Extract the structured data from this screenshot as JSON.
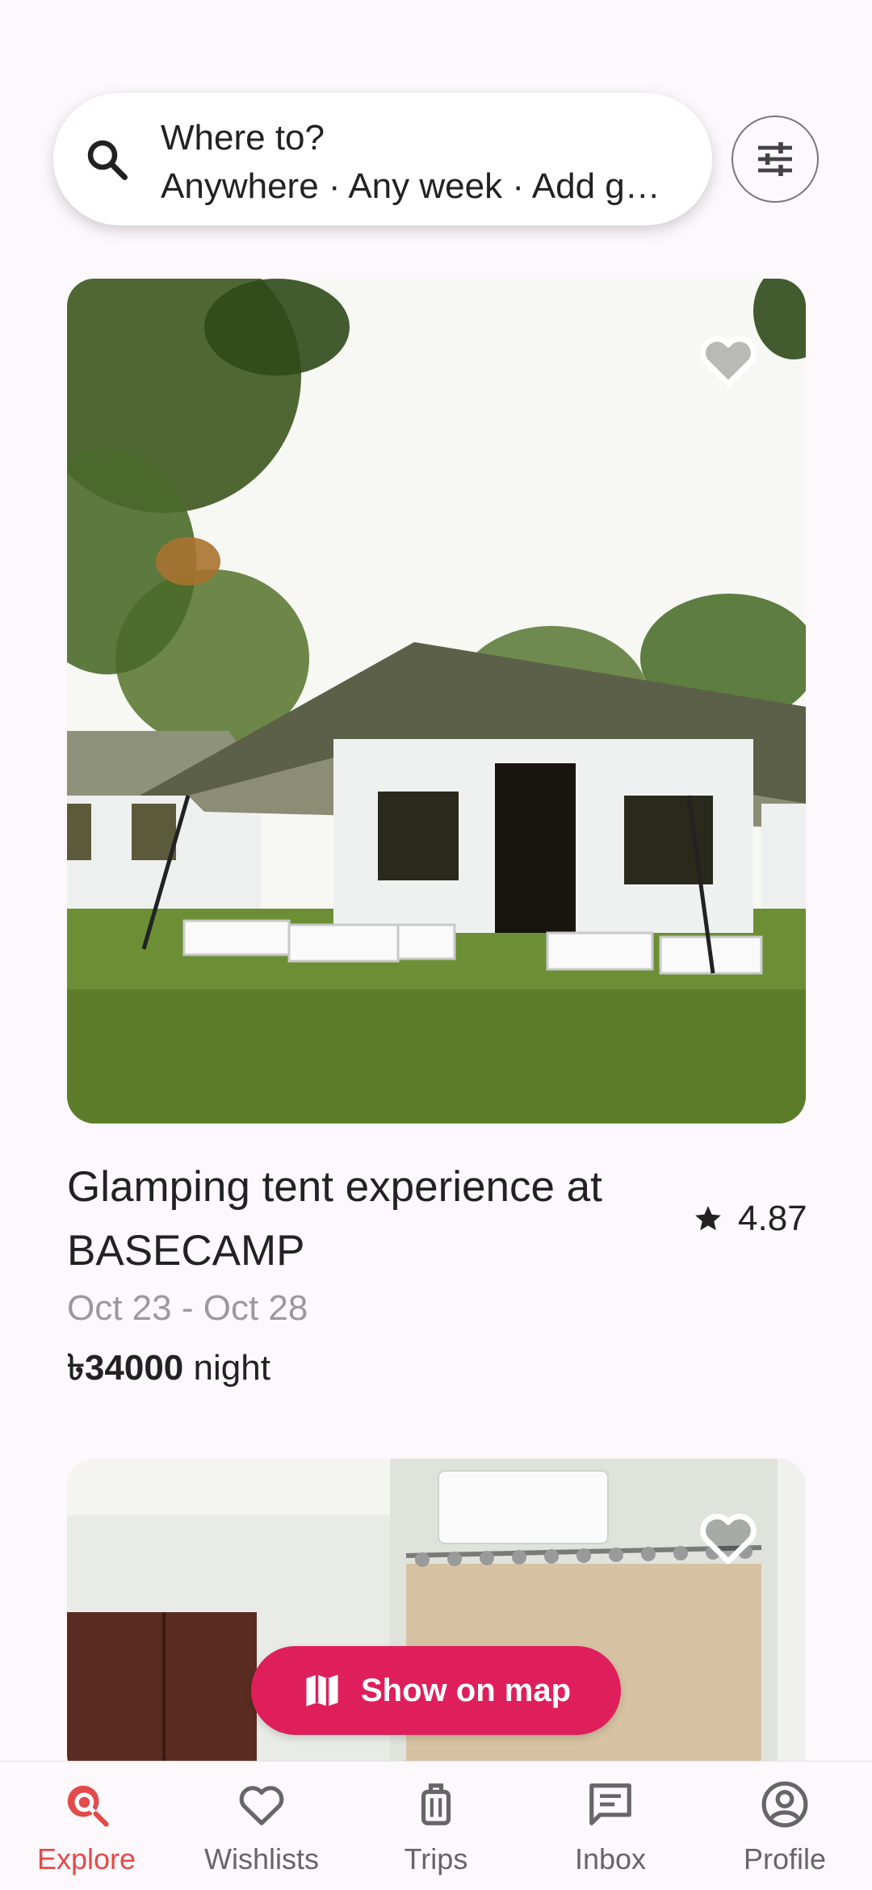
{
  "search": {
    "title": "Where to?",
    "subtitle": "Anywhere · Any week · Add guests"
  },
  "listings": [
    {
      "title": "Glamping tent experience at BASECAMP",
      "rating": "4.87",
      "dates": "Oct 23 - Oct 28",
      "price": "৳34000",
      "price_unit": "night"
    }
  ],
  "map_button": {
    "label": "Show on map"
  },
  "nav": {
    "items": [
      {
        "label": "Explore",
        "icon": "explore-icon",
        "active": true
      },
      {
        "label": "Wishlists",
        "icon": "heart-icon",
        "active": false
      },
      {
        "label": "Trips",
        "icon": "luggage-icon",
        "active": false
      },
      {
        "label": "Inbox",
        "icon": "message-icon",
        "active": false
      },
      {
        "label": "Profile",
        "icon": "account-icon",
        "active": false
      }
    ]
  },
  "colors": {
    "accent": "#df1f5b",
    "active_nav": "#e34a4a"
  }
}
